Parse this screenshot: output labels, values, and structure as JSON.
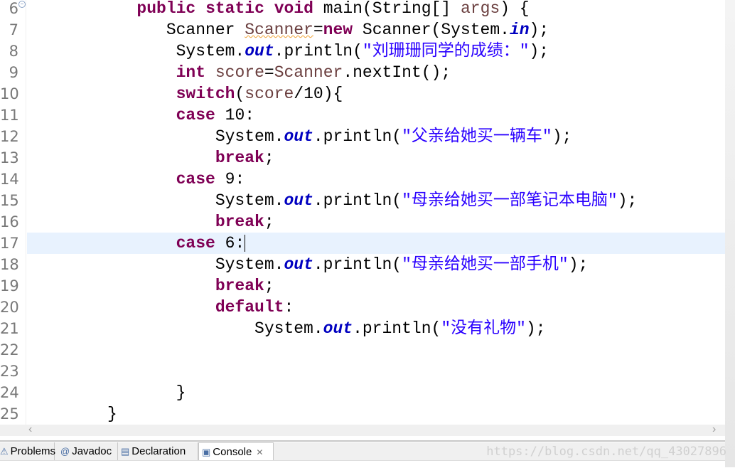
{
  "editor": {
    "current_line": 17,
    "lines": [
      {
        "n": "6",
        "fold": true,
        "tokens": [
          [
            "   ",
            ""
          ],
          [
            "public",
            "kw"
          ],
          [
            " ",
            ""
          ],
          [
            "static",
            "kw"
          ],
          [
            " ",
            ""
          ],
          [
            "void",
            "kw"
          ],
          [
            " main(String[] ",
            ""
          ],
          [
            "args",
            "var"
          ],
          [
            ") {",
            ""
          ]
        ]
      },
      {
        "n": "7",
        "tokens": [
          [
            "      Scanner ",
            ""
          ],
          [
            "Scanner",
            "var warn"
          ],
          [
            "=",
            ""
          ],
          [
            "new",
            "kw"
          ],
          [
            " Scanner(System.",
            ""
          ],
          [
            "in",
            "fld"
          ],
          [
            ");",
            ""
          ]
        ]
      },
      {
        "n": "8",
        "tokens": [
          [
            "       System.",
            ""
          ],
          [
            "out",
            "fld"
          ],
          [
            ".println(",
            ""
          ],
          [
            "\"刘珊珊同学的成绩：\"",
            "str"
          ],
          [
            ");",
            ""
          ]
        ]
      },
      {
        "n": "9",
        "tokens": [
          [
            "       ",
            ""
          ],
          [
            "int",
            "kw"
          ],
          [
            " ",
            ""
          ],
          [
            "score",
            "var"
          ],
          [
            "=",
            ""
          ],
          [
            "Scanner",
            "var"
          ],
          [
            ".nextInt();",
            ""
          ]
        ]
      },
      {
        "n": "10",
        "tokens": [
          [
            "       ",
            ""
          ],
          [
            "switch",
            "kw"
          ],
          [
            "(",
            ""
          ],
          [
            "score",
            "var"
          ],
          [
            "/10){",
            ""
          ]
        ]
      },
      {
        "n": "11",
        "tokens": [
          [
            "       ",
            ""
          ],
          [
            "case",
            "kw"
          ],
          [
            " 10:",
            ""
          ]
        ]
      },
      {
        "n": "12",
        "tokens": [
          [
            "           System.",
            ""
          ],
          [
            "out",
            "fld"
          ],
          [
            ".println(",
            ""
          ],
          [
            "\"父亲给她买一辆车\"",
            "str"
          ],
          [
            ");",
            ""
          ]
        ]
      },
      {
        "n": "13",
        "tokens": [
          [
            "           ",
            ""
          ],
          [
            "break",
            "kw"
          ],
          [
            ";",
            ""
          ]
        ]
      },
      {
        "n": "14",
        "tokens": [
          [
            "       ",
            ""
          ],
          [
            "case",
            "kw"
          ],
          [
            " 9:",
            ""
          ]
        ]
      },
      {
        "n": "15",
        "tokens": [
          [
            "           System.",
            ""
          ],
          [
            "out",
            "fld"
          ],
          [
            ".println(",
            ""
          ],
          [
            "\"母亲给她买一部笔记本电脑\"",
            "str"
          ],
          [
            ");",
            ""
          ]
        ]
      },
      {
        "n": "16",
        "tokens": [
          [
            "           ",
            ""
          ],
          [
            "break",
            "kw"
          ],
          [
            ";",
            ""
          ]
        ]
      },
      {
        "n": "17",
        "tokens": [
          [
            "       ",
            ""
          ],
          [
            "case",
            "kw"
          ],
          [
            " 6:",
            ""
          ]
        ],
        "caret": true
      },
      {
        "n": "18",
        "tokens": [
          [
            "           System.",
            ""
          ],
          [
            "out",
            "fld"
          ],
          [
            ".println(",
            ""
          ],
          [
            "\"母亲给她买一部手机\"",
            "str"
          ],
          [
            ");",
            ""
          ]
        ]
      },
      {
        "n": "19",
        "tokens": [
          [
            "           ",
            ""
          ],
          [
            "break",
            "kw"
          ],
          [
            ";",
            ""
          ]
        ]
      },
      {
        "n": "20",
        "tokens": [
          [
            "           ",
            ""
          ],
          [
            "default",
            "kw"
          ],
          [
            ":",
            ""
          ]
        ]
      },
      {
        "n": "21",
        "tokens": [
          [
            "               System.",
            ""
          ],
          [
            "out",
            "fld"
          ],
          [
            ".println(",
            ""
          ],
          [
            "\"没有礼物\"",
            "str"
          ],
          [
            ");",
            ""
          ]
        ]
      },
      {
        "n": "22",
        "tokens": []
      },
      {
        "n": "23",
        "tokens": []
      },
      {
        "n": "24",
        "tokens": [
          [
            "       }",
            ""
          ]
        ]
      },
      {
        "n": "25",
        "tokens": [
          [
            "}",
            ""
          ]
        ]
      }
    ]
  },
  "scrollbar": {
    "left_arrow": "‹",
    "right_arrow": "›"
  },
  "tabs": [
    {
      "label": "Problems",
      "icon": "problems-icon",
      "glyph": "⚠",
      "active": false
    },
    {
      "label": "Javadoc",
      "icon": "at-icon",
      "glyph": "@",
      "active": false
    },
    {
      "label": "Declaration",
      "icon": "declaration-icon",
      "glyph": "▤",
      "active": false
    },
    {
      "label": "Console",
      "icon": "console-icon",
      "glyph": "▣",
      "active": true,
      "close": "✕"
    }
  ],
  "watermark": "https://blog.csdn.net/qq_43027896",
  "colors": {
    "keyword": "#7f0055",
    "field": "#0000c0",
    "string": "#2a00ff",
    "variable": "#6a3e3e",
    "current_line": "#e8f2fe"
  }
}
